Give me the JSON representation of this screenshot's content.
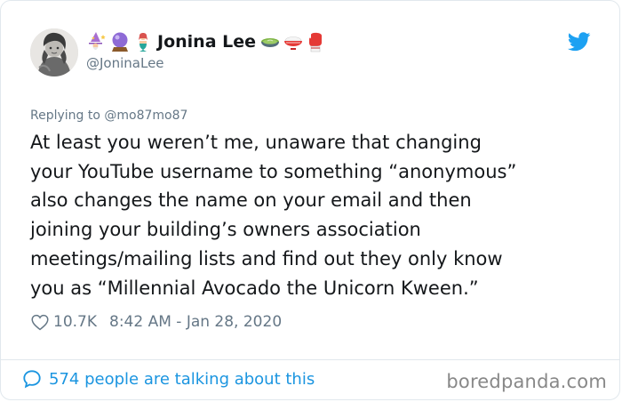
{
  "author": {
    "name_prefix_icons": [
      "wizard-emoji-icon",
      "crystal-ball-emoji-icon",
      "mermaid-emoji-icon"
    ],
    "name": "Jonina Lee",
    "name_suffix_icons": [
      "matcha-emoji-icon",
      "rice-bowl-emoji-icon",
      "boxing-glove-emoji-icon"
    ],
    "handle": "@JoninaLee"
  },
  "reply": {
    "prefix": "Replying to ",
    "to": "@mo87mo87"
  },
  "tweet": {
    "text": "At least you weren’t me, unaware that changing\nyour YouTube username to something “anonymous”\nalso changes the name on your email and then\njoining your building’s owners association\nmeetings/mailing lists and find out they only know\nyou as “Millennial Avocado the Unicorn Kween.”"
  },
  "meta": {
    "likes": "10.7K",
    "timestamp": "8:42 AM - Jan 28, 2020"
  },
  "footer": {
    "talking": "574 people are talking about this",
    "watermark": "boredpanda.com"
  },
  "colors": {
    "twitter_blue": "#1da1f2",
    "link_blue": "#1b95e0",
    "muted": "#657786",
    "text": "#14171a"
  }
}
